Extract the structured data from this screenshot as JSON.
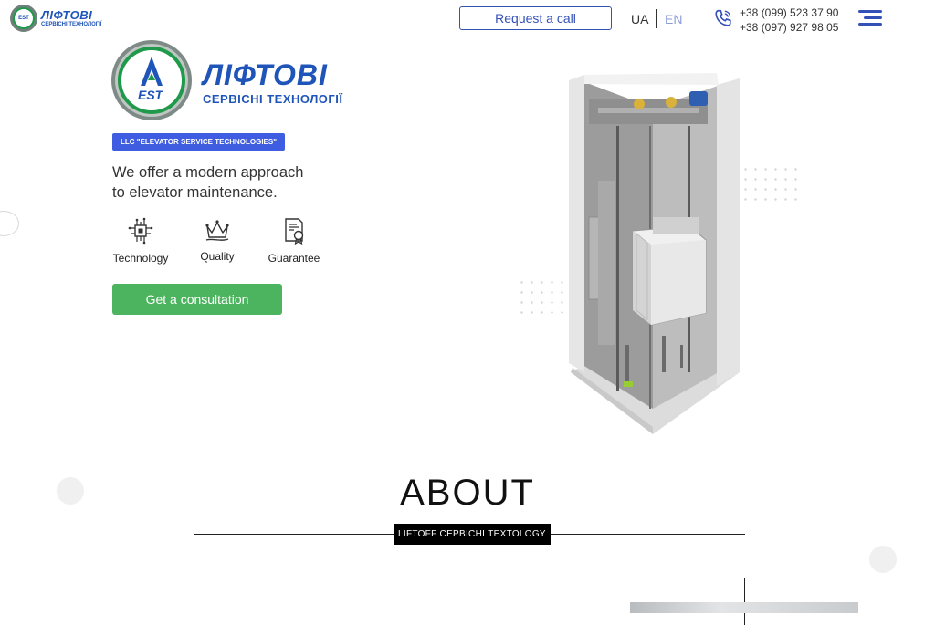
{
  "header": {
    "logo_title": "ЛІФТОВІ",
    "logo_subtitle": "СЕРВІСНІ ТЕХНОЛОГІЇ",
    "logo_mark": "EST",
    "request_call_label": "Request a call",
    "lang_ua": "UA",
    "lang_en": "EN",
    "phones": [
      "+38 (099) 523 37 90",
      "+38 (097) 927 98 05"
    ],
    "menu_icon": "hamburger-icon"
  },
  "hero": {
    "logo_title": "ЛІФТОВІ",
    "logo_subtitle": "СЕРВІСНІ ТЕХНОЛОГІЇ",
    "logo_mark": "EST",
    "badge": "LLC \"ELEVATOR SERVICE TECHNOLOGIES\"",
    "tagline_line1": "We offer a modern approach",
    "tagline_line2": "to elevator maintenance.",
    "features": [
      {
        "label": "Technology",
        "icon": "chip-icon"
      },
      {
        "label": "Quality",
        "icon": "crown-icon"
      },
      {
        "label": "Guarantee",
        "icon": "certificate-icon"
      }
    ],
    "cta_label": "Get a consultation",
    "image": "elevator-shaft-illustration"
  },
  "about": {
    "title": "ABOUT",
    "label": "LIFTOFF СЕРВІСНІ TEXTOLOGY"
  },
  "colors": {
    "brand_blue": "#3451b8",
    "badge_blue": "#3f5de0",
    "cta_green": "#4cb35e",
    "logo_green": "#1e9a4a"
  }
}
